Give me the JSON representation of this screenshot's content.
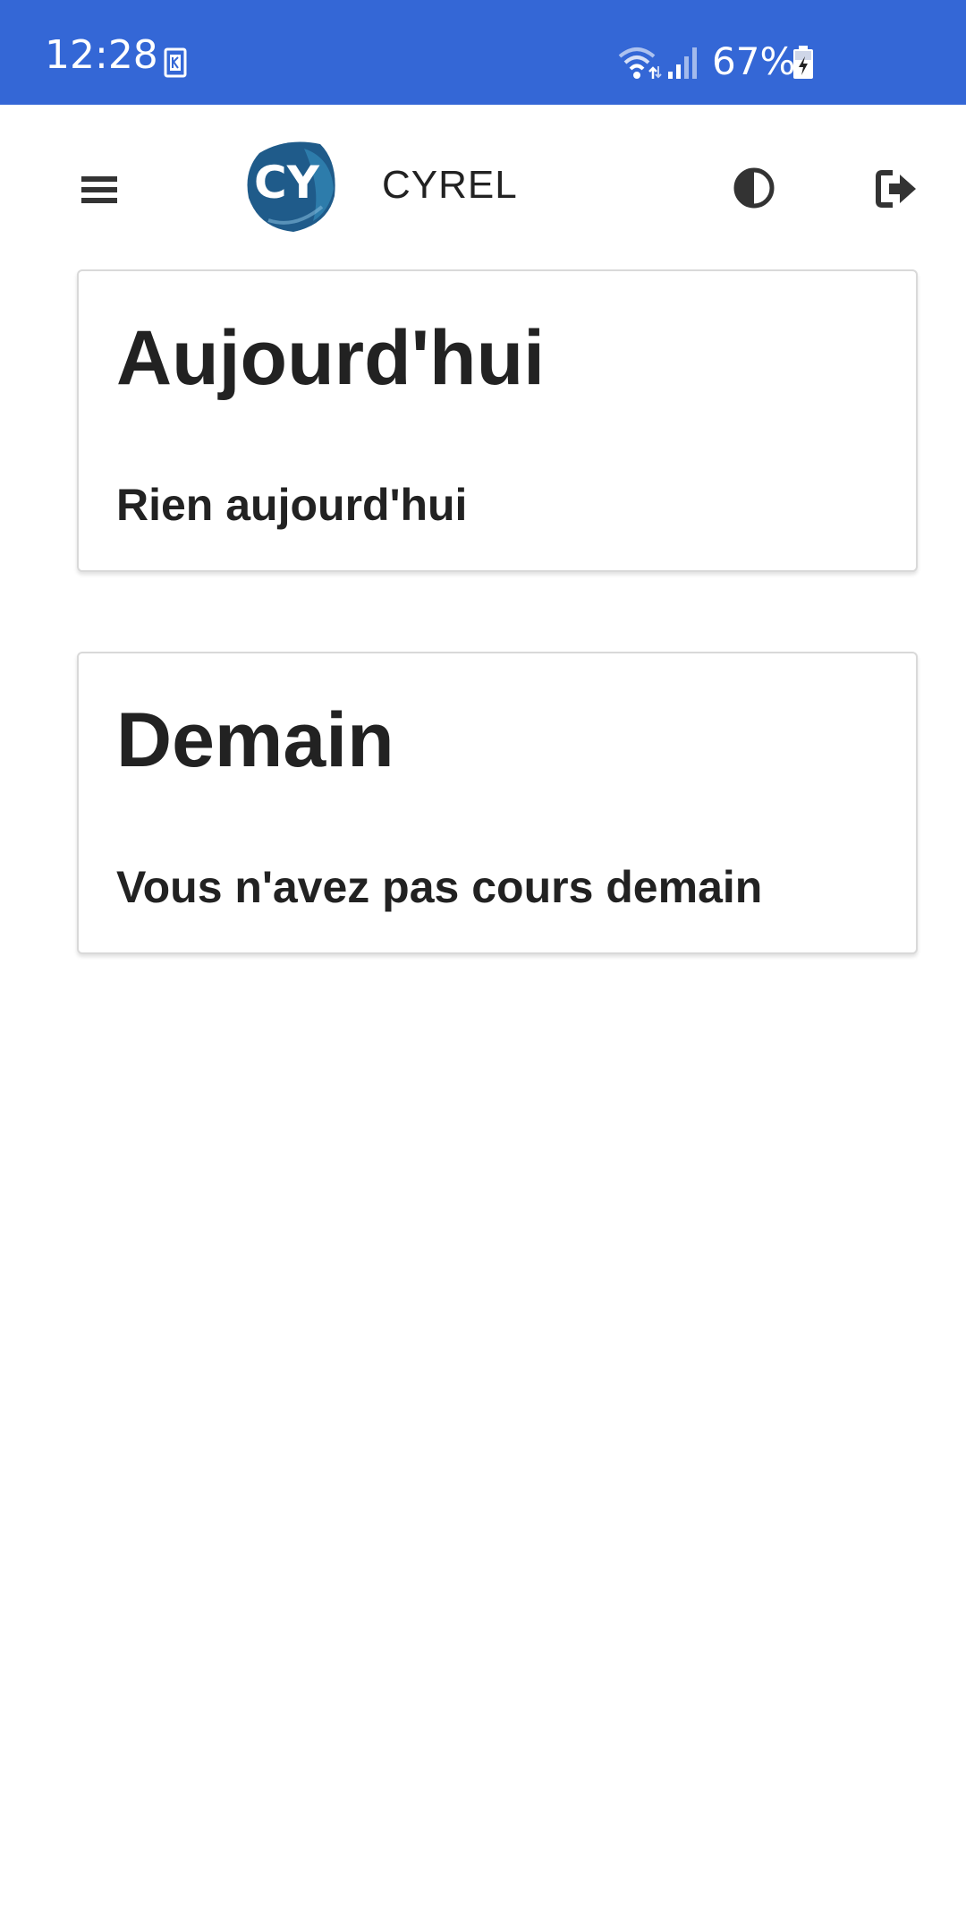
{
  "status_bar": {
    "time": "12:28",
    "battery": "67%",
    "notification_icon": "k-notification-icon",
    "wifi_icon": "wifi-icon",
    "signal_icon": "cell-signal-icon",
    "battery_icon": "battery-charging-icon",
    "background_color": "#3467d6"
  },
  "header": {
    "app_title": "CYREL",
    "logo_text": "CY",
    "menu_icon": "hamburger-menu-icon",
    "theme_icon": "contrast-toggle-icon",
    "logout_icon": "logout-icon"
  },
  "cards": {
    "today": {
      "heading": "Aujourd'hui",
      "message": "Rien aujourd'hui"
    },
    "tomorrow": {
      "heading": "Demain",
      "message": "Vous n'avez pas cours demain"
    }
  }
}
